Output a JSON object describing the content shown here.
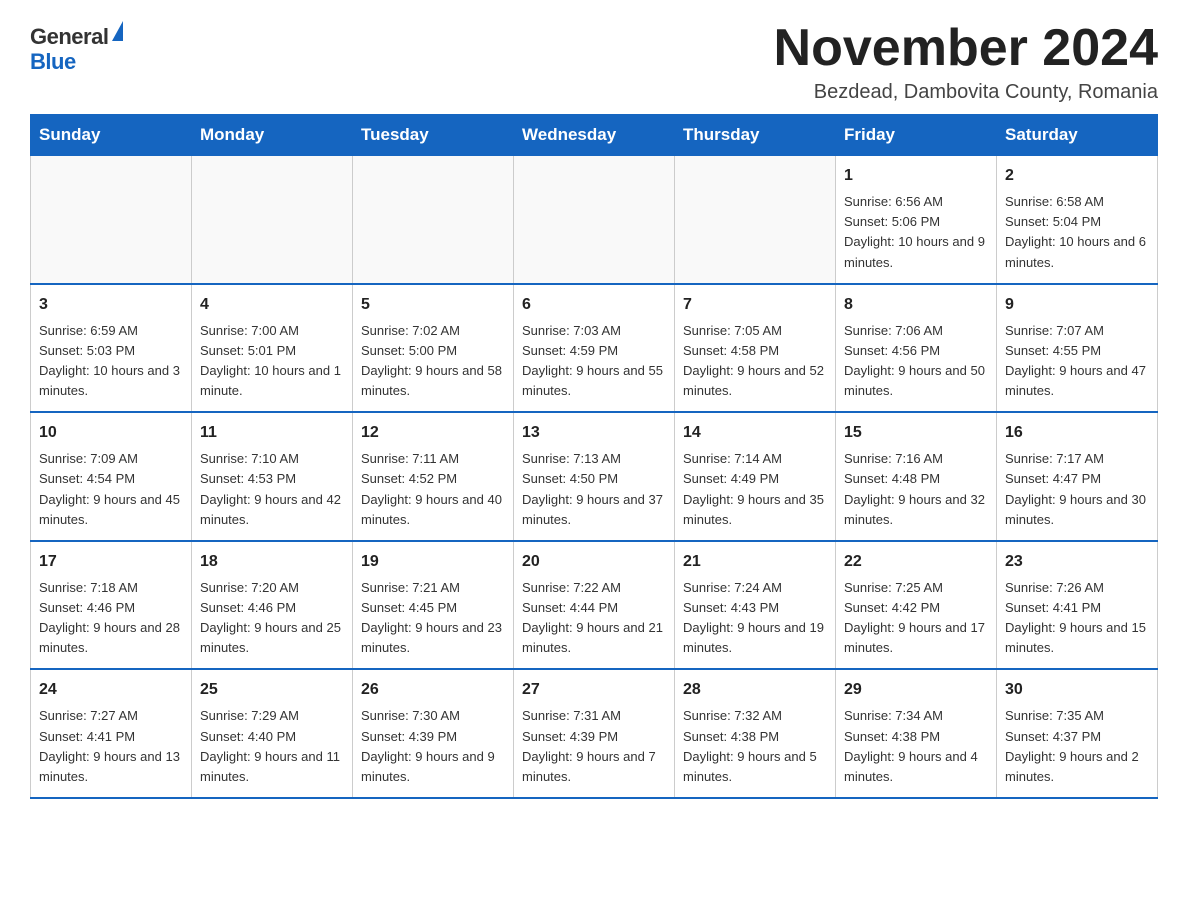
{
  "header": {
    "logo_general": "General",
    "logo_blue": "Blue",
    "title": "November 2024",
    "location": "Bezdead, Dambovita County, Romania"
  },
  "calendar": {
    "days_of_week": [
      "Sunday",
      "Monday",
      "Tuesday",
      "Wednesday",
      "Thursday",
      "Friday",
      "Saturday"
    ],
    "weeks": [
      [
        {
          "day": "",
          "info": ""
        },
        {
          "day": "",
          "info": ""
        },
        {
          "day": "",
          "info": ""
        },
        {
          "day": "",
          "info": ""
        },
        {
          "day": "",
          "info": ""
        },
        {
          "day": "1",
          "info": "Sunrise: 6:56 AM\nSunset: 5:06 PM\nDaylight: 10 hours and 9 minutes."
        },
        {
          "day": "2",
          "info": "Sunrise: 6:58 AM\nSunset: 5:04 PM\nDaylight: 10 hours and 6 minutes."
        }
      ],
      [
        {
          "day": "3",
          "info": "Sunrise: 6:59 AM\nSunset: 5:03 PM\nDaylight: 10 hours and 3 minutes."
        },
        {
          "day": "4",
          "info": "Sunrise: 7:00 AM\nSunset: 5:01 PM\nDaylight: 10 hours and 1 minute."
        },
        {
          "day": "5",
          "info": "Sunrise: 7:02 AM\nSunset: 5:00 PM\nDaylight: 9 hours and 58 minutes."
        },
        {
          "day": "6",
          "info": "Sunrise: 7:03 AM\nSunset: 4:59 PM\nDaylight: 9 hours and 55 minutes."
        },
        {
          "day": "7",
          "info": "Sunrise: 7:05 AM\nSunset: 4:58 PM\nDaylight: 9 hours and 52 minutes."
        },
        {
          "day": "8",
          "info": "Sunrise: 7:06 AM\nSunset: 4:56 PM\nDaylight: 9 hours and 50 minutes."
        },
        {
          "day": "9",
          "info": "Sunrise: 7:07 AM\nSunset: 4:55 PM\nDaylight: 9 hours and 47 minutes."
        }
      ],
      [
        {
          "day": "10",
          "info": "Sunrise: 7:09 AM\nSunset: 4:54 PM\nDaylight: 9 hours and 45 minutes."
        },
        {
          "day": "11",
          "info": "Sunrise: 7:10 AM\nSunset: 4:53 PM\nDaylight: 9 hours and 42 minutes."
        },
        {
          "day": "12",
          "info": "Sunrise: 7:11 AM\nSunset: 4:52 PM\nDaylight: 9 hours and 40 minutes."
        },
        {
          "day": "13",
          "info": "Sunrise: 7:13 AM\nSunset: 4:50 PM\nDaylight: 9 hours and 37 minutes."
        },
        {
          "day": "14",
          "info": "Sunrise: 7:14 AM\nSunset: 4:49 PM\nDaylight: 9 hours and 35 minutes."
        },
        {
          "day": "15",
          "info": "Sunrise: 7:16 AM\nSunset: 4:48 PM\nDaylight: 9 hours and 32 minutes."
        },
        {
          "day": "16",
          "info": "Sunrise: 7:17 AM\nSunset: 4:47 PM\nDaylight: 9 hours and 30 minutes."
        }
      ],
      [
        {
          "day": "17",
          "info": "Sunrise: 7:18 AM\nSunset: 4:46 PM\nDaylight: 9 hours and 28 minutes."
        },
        {
          "day": "18",
          "info": "Sunrise: 7:20 AM\nSunset: 4:46 PM\nDaylight: 9 hours and 25 minutes."
        },
        {
          "day": "19",
          "info": "Sunrise: 7:21 AM\nSunset: 4:45 PM\nDaylight: 9 hours and 23 minutes."
        },
        {
          "day": "20",
          "info": "Sunrise: 7:22 AM\nSunset: 4:44 PM\nDaylight: 9 hours and 21 minutes."
        },
        {
          "day": "21",
          "info": "Sunrise: 7:24 AM\nSunset: 4:43 PM\nDaylight: 9 hours and 19 minutes."
        },
        {
          "day": "22",
          "info": "Sunrise: 7:25 AM\nSunset: 4:42 PM\nDaylight: 9 hours and 17 minutes."
        },
        {
          "day": "23",
          "info": "Sunrise: 7:26 AM\nSunset: 4:41 PM\nDaylight: 9 hours and 15 minutes."
        }
      ],
      [
        {
          "day": "24",
          "info": "Sunrise: 7:27 AM\nSunset: 4:41 PM\nDaylight: 9 hours and 13 minutes."
        },
        {
          "day": "25",
          "info": "Sunrise: 7:29 AM\nSunset: 4:40 PM\nDaylight: 9 hours and 11 minutes."
        },
        {
          "day": "26",
          "info": "Sunrise: 7:30 AM\nSunset: 4:39 PM\nDaylight: 9 hours and 9 minutes."
        },
        {
          "day": "27",
          "info": "Sunrise: 7:31 AM\nSunset: 4:39 PM\nDaylight: 9 hours and 7 minutes."
        },
        {
          "day": "28",
          "info": "Sunrise: 7:32 AM\nSunset: 4:38 PM\nDaylight: 9 hours and 5 minutes."
        },
        {
          "day": "29",
          "info": "Sunrise: 7:34 AM\nSunset: 4:38 PM\nDaylight: 9 hours and 4 minutes."
        },
        {
          "day": "30",
          "info": "Sunrise: 7:35 AM\nSunset: 4:37 PM\nDaylight: 9 hours and 2 minutes."
        }
      ]
    ]
  }
}
